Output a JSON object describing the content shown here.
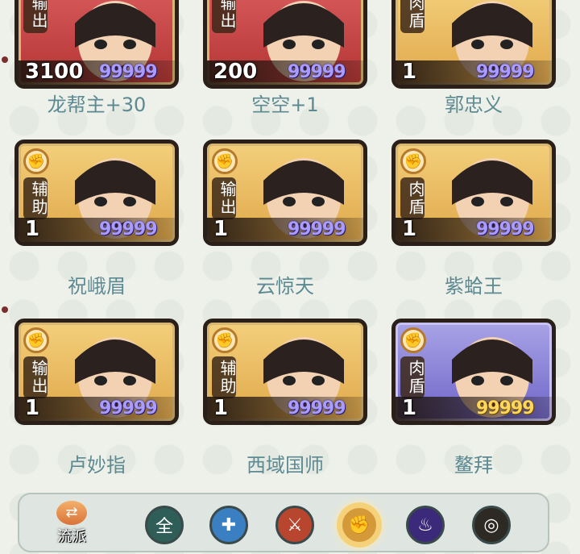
{
  "heroes": [
    {
      "name": "龙帮主+30",
      "role": "输出",
      "level": "3100",
      "power": "99999",
      "frame": "red",
      "has_icon": false
    },
    {
      "name": "空空+1",
      "role": "输出",
      "level": "200",
      "power": "99999",
      "frame": "red",
      "has_icon": false
    },
    {
      "name": "郭忠义",
      "role": "肉盾",
      "level": "1",
      "power": "99999",
      "frame": "gold",
      "has_icon": false
    },
    {
      "name": "祝峨眉",
      "role": "辅助",
      "level": "1",
      "power": "99999",
      "frame": "gold",
      "has_icon": true
    },
    {
      "name": "云惊天",
      "role": "输出",
      "level": "1",
      "power": "99999",
      "frame": "gold",
      "has_icon": true
    },
    {
      "name": "紫蛤王",
      "role": "肉盾",
      "level": "1",
      "power": "99999",
      "frame": "gold",
      "has_icon": true
    },
    {
      "name": "卢妙指",
      "role": "输出",
      "level": "1",
      "power": "99999",
      "frame": "gold",
      "has_icon": true
    },
    {
      "name": "西域国师",
      "role": "辅助",
      "level": "1",
      "power": "99999",
      "frame": "gold",
      "has_icon": true
    },
    {
      "name": "鳌拜",
      "role": "肉盾",
      "level": "1",
      "power": "99999",
      "frame": "purple",
      "has_icon": true
    }
  ],
  "nav": {
    "school_label": "流派",
    "all_label": "全",
    "filters": [
      {
        "icon": "all-icon",
        "color": "#2f5e58"
      },
      {
        "icon": "sword-icon",
        "color": "#3a7fc2"
      },
      {
        "icon": "blade-icon",
        "color": "#b8462e"
      },
      {
        "icon": "fist-icon",
        "color": "#d49a3a",
        "selected": true
      },
      {
        "icon": "flame-icon",
        "color": "#3b2a7a"
      },
      {
        "icon": "swirl-icon",
        "color": "#2c2a22"
      }
    ]
  }
}
